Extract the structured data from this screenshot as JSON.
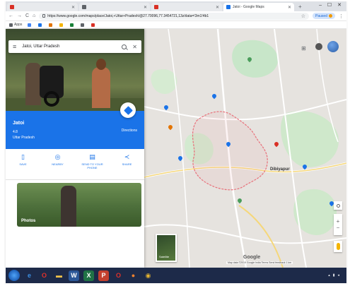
{
  "browser": {
    "tabs": [
      {
        "label": "",
        "favicon_color": "#d93025",
        "active": false
      },
      {
        "label": "",
        "favicon_color": "#5f6368",
        "active": false
      },
      {
        "label": "",
        "favicon_color": "#d93025",
        "active": false
      },
      {
        "label": "Jatoi - Google Maps",
        "favicon_color": "#1a73e8",
        "active": true
      }
    ],
    "new_tab": "+",
    "window_controls": "– ☐ ✕",
    "nav": {
      "back": "←",
      "forward": "→",
      "reload": "C",
      "home": "⌂"
    },
    "url": "https://www.google.com/maps/place/Jatoi,+Uttar+Pradesh/@27.70096,77.3454721,13z/data=!3m1!4b1",
    "paused_label": "Paused",
    "bookmarks": [
      {
        "label": "Apps",
        "color": "#5f6368"
      },
      {
        "label": "",
        "color": "#4285f4"
      },
      {
        "label": "",
        "color": "#1a73e8"
      },
      {
        "label": "",
        "color": "#e37400"
      },
      {
        "label": "",
        "color": "#f4b400"
      },
      {
        "label": "",
        "color": "#188038"
      },
      {
        "label": "",
        "color": "#5f6368"
      },
      {
        "label": "",
        "color": "#d93025"
      }
    ]
  },
  "maps": {
    "search_value": "Jatoi, Uttar Pradesh",
    "place_name": "Jatoi",
    "place_rating": "4.8",
    "place_region": "Uttar Pradesh",
    "directions_label": "Directions",
    "actions": [
      {
        "label": "SAVE",
        "icon": "bookmark-icon",
        "glyph": "▯"
      },
      {
        "label": "NEARBY",
        "icon": "nearby-icon",
        "glyph": "◎"
      },
      {
        "label": "SEND TO YOUR PHONE",
        "icon": "phone-icon",
        "glyph": "▤"
      },
      {
        "label": "SHARE",
        "icon": "share-icon",
        "glyph": "≺"
      }
    ],
    "photos_label": "Photos",
    "satellite_label": "Satellite",
    "google_logo": "Google",
    "attribution": "Map data ©2019 Google  India  Terms  Send feedback  1 km",
    "places": [
      {
        "label": "",
        "green": false
      },
      {
        "label": "",
        "green": true
      },
      {
        "label": "",
        "green": false
      },
      {
        "label": "",
        "green": false
      },
      {
        "label": "",
        "green": false
      },
      {
        "label": "",
        "green": false
      },
      {
        "label": "",
        "green": false
      },
      {
        "label": "",
        "green": false
      },
      {
        "label": "",
        "green": false
      },
      {
        "label": "",
        "green": false
      },
      {
        "label": "",
        "green": false
      },
      {
        "label": "",
        "green": false
      },
      {
        "label": "",
        "green": false
      },
      {
        "label": "",
        "green": false
      },
      {
        "label": "",
        "green": false
      },
      {
        "label": "Dibiyapur",
        "green": false
      },
      {
        "label": "",
        "green": false
      },
      {
        "label": "",
        "green": false
      },
      {
        "label": "",
        "green": false
      },
      {
        "label": "",
        "green": false
      }
    ],
    "zoom_in": "+",
    "zoom_out": "−",
    "accent": "#1a73e8",
    "boundary_color": "#e8707a"
  },
  "taskbar": {
    "items": [
      {
        "icon": "ie-icon",
        "glyph": "e",
        "color": "#3b8ee0",
        "bg": "transparent"
      },
      {
        "icon": "opera-icon",
        "glyph": "O",
        "color": "#e0312b",
        "bg": "transparent"
      },
      {
        "icon": "folder-icon",
        "glyph": "▬",
        "color": "#f2c34a",
        "bg": "transparent"
      },
      {
        "icon": "word-icon",
        "glyph": "W",
        "color": "#ffffff",
        "bg": "#2b5797"
      },
      {
        "icon": "excel-icon",
        "glyph": "X",
        "color": "#ffffff",
        "bg": "#207245"
      },
      {
        "icon": "powerpoint-icon",
        "glyph": "P",
        "color": "#ffffff",
        "bg": "#c4402e"
      },
      {
        "icon": "opera-alt-icon",
        "glyph": "O",
        "color": "#e0312b",
        "bg": "transparent"
      },
      {
        "icon": "firefox-icon",
        "glyph": "●",
        "color": "#f0812f",
        "bg": "transparent"
      },
      {
        "icon": "chrome-icon",
        "glyph": "◉",
        "color": "#e8b631",
        "bg": "transparent"
      }
    ],
    "time": "",
    "date": ""
  }
}
